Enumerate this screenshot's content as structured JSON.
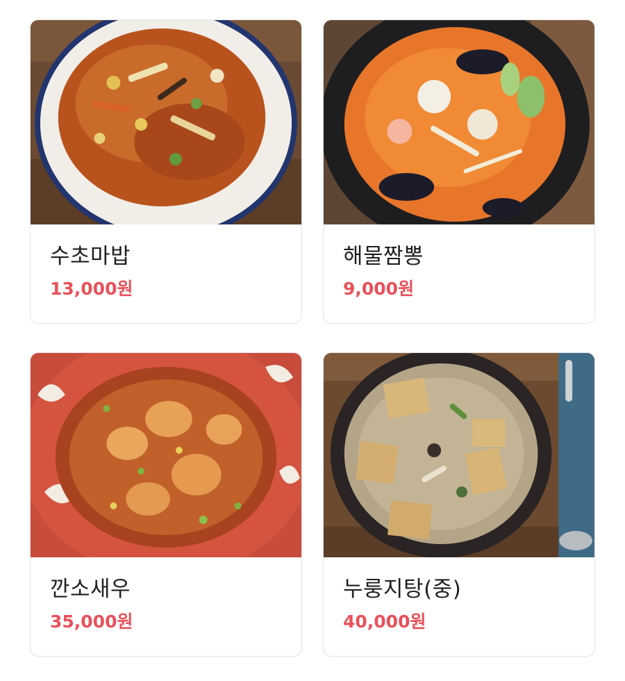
{
  "menu": {
    "items": [
      {
        "name": "수초마밥",
        "price": "13,000원",
        "image_icon": "stir-fried-rice-noodle-dish-icon"
      },
      {
        "name": "해물짬뽕",
        "price": "9,000원",
        "image_icon": "seafood-spicy-noodle-soup-icon"
      },
      {
        "name": "깐소새우",
        "price": "35,000원",
        "image_icon": "sweet-chili-shrimp-icon"
      },
      {
        "name": "누룽지탕(중)",
        "price": "40,000원",
        "image_icon": "scorched-rice-soup-icon"
      }
    ]
  },
  "colors": {
    "price_accent": "#e8515a",
    "name_text": "#1f1f1f",
    "card_border": "#e3e3e3"
  }
}
